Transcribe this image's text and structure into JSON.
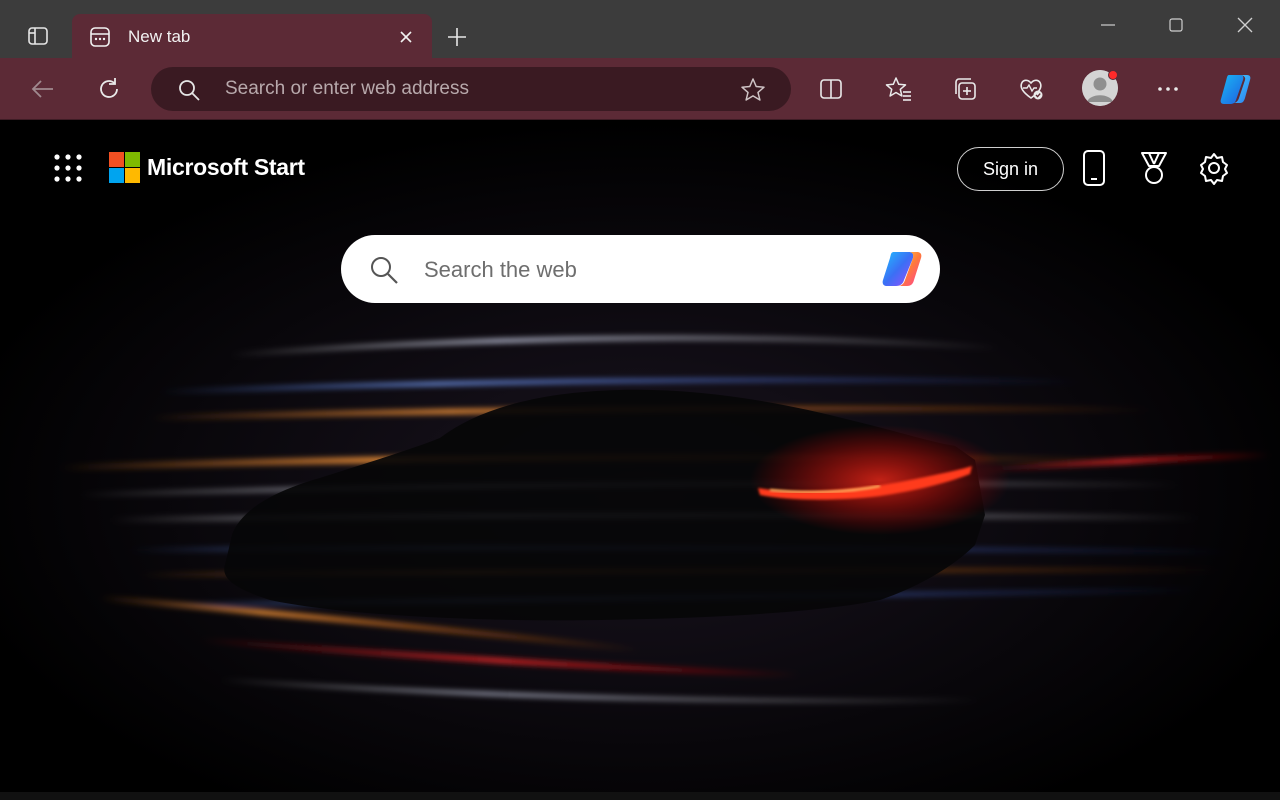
{
  "browser": {
    "tab": {
      "title": "New tab"
    },
    "address_bar": {
      "placeholder": "Search or enter web address"
    }
  },
  "page": {
    "logo_text": "Microsoft Start",
    "sign_in_label": "Sign in",
    "search": {
      "placeholder": "Search the web"
    }
  },
  "colors": {
    "tabstrip": "#3c3c3c",
    "toolbar": "#5c2a36",
    "address_bg": "#3a1a22",
    "logo_red": "#f25022",
    "logo_green": "#7fba00",
    "logo_blue": "#00a4ef",
    "logo_yellow": "#ffb900",
    "profile_notification": "#ff2a2a"
  },
  "icons": [
    "tab-actions-icon",
    "new-tab-page-icon",
    "close-icon",
    "plus-icon",
    "minimize-icon",
    "maximize-icon",
    "close-window-icon",
    "back-arrow-icon",
    "refresh-icon",
    "search-icon",
    "star-icon",
    "split-screen-icon",
    "favorites-icon",
    "collections-icon",
    "browser-essentials-icon",
    "profile-icon",
    "more-icon",
    "copilot-icon",
    "apps-grid-icon",
    "phone-icon",
    "rewards-medal-icon",
    "settings-gear-icon"
  ]
}
